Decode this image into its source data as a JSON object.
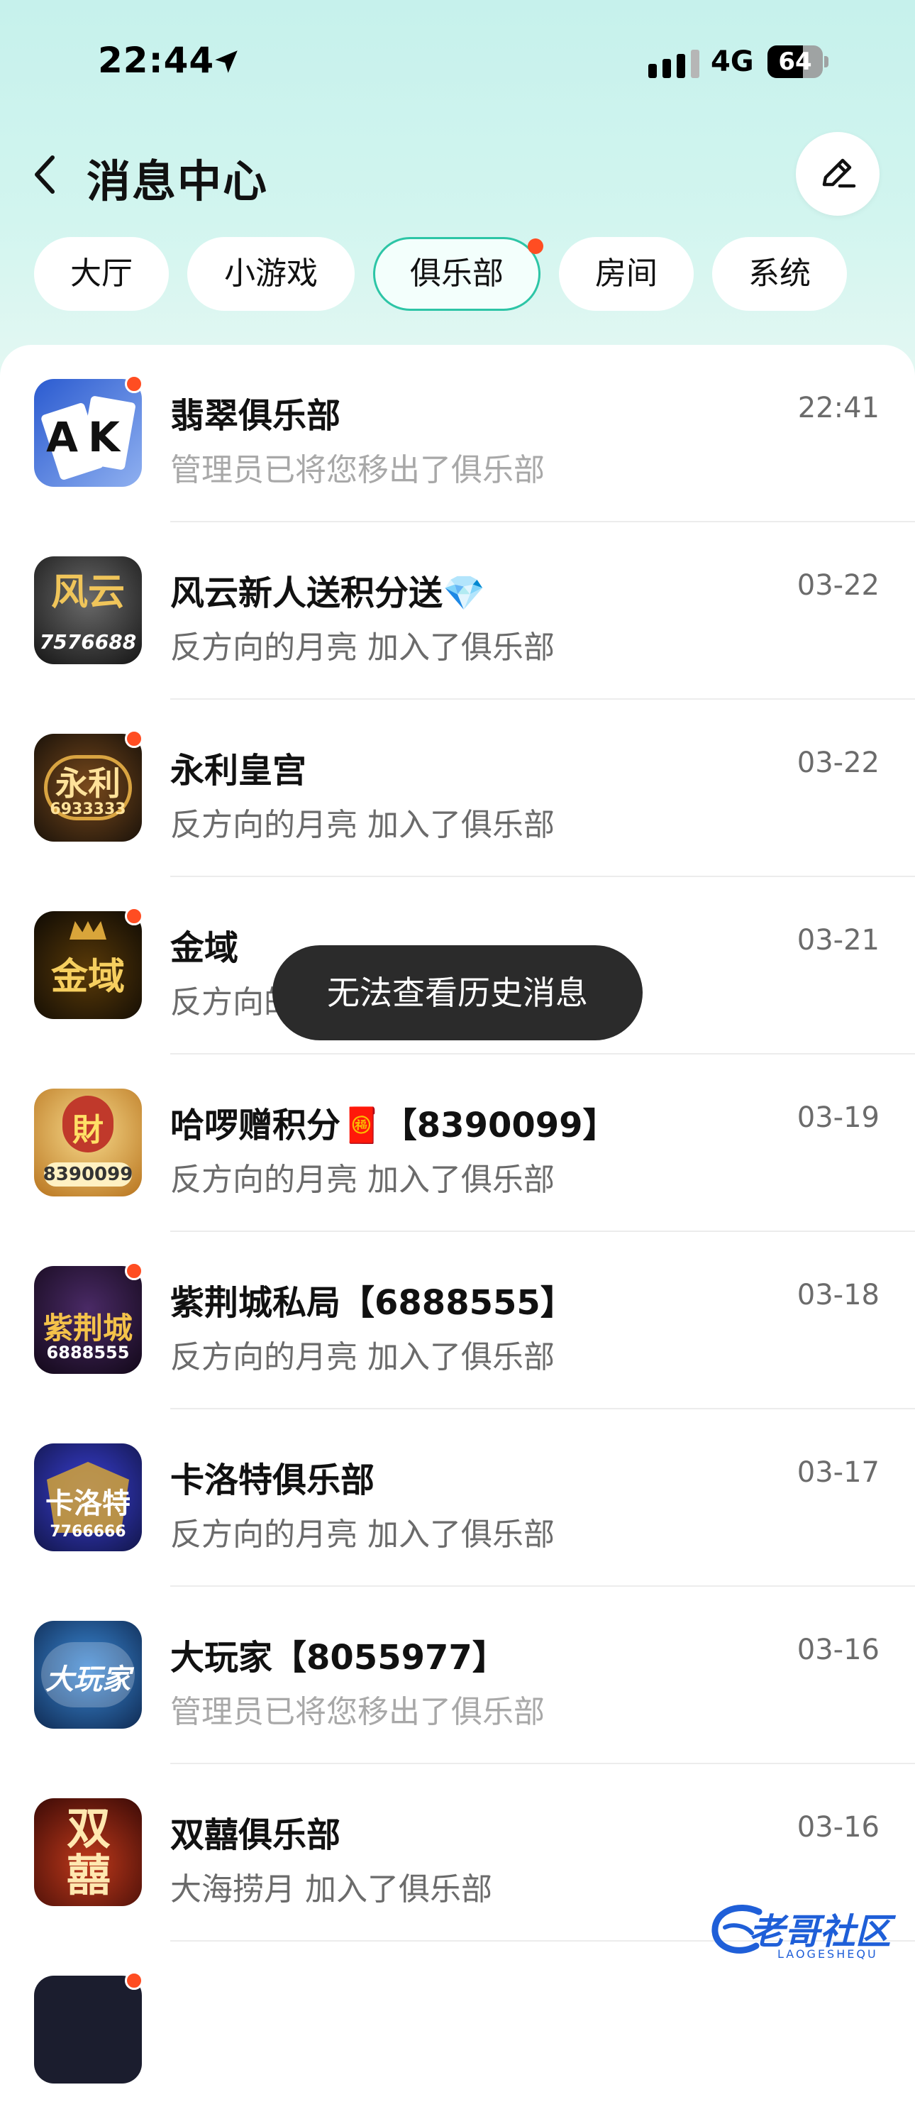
{
  "status_bar": {
    "time": "22:44",
    "network": "4G",
    "battery": "64",
    "battery_level": 0.64
  },
  "header": {
    "title": "消息中心"
  },
  "tabs": [
    {
      "label": "大厅"
    },
    {
      "label": "小游戏"
    },
    {
      "label": "俱乐部",
      "active": true,
      "has_dot": true
    },
    {
      "label": "房间"
    },
    {
      "label": "系统"
    }
  ],
  "messages": [
    {
      "name": "翡翠俱乐部",
      "message": "管理员已将您移出了俱乐部",
      "time": "22:41",
      "unread": true,
      "avatar_text": "AK"
    },
    {
      "name": "风云新人送积分送💎",
      "message": "反方向的月亮 加入了俱乐部",
      "time": "03-22",
      "unread": false,
      "avatar_text": "风云",
      "avatar_sub": "7576688"
    },
    {
      "name": "永利皇宫",
      "message": "反方向的月亮 加入了俱乐部",
      "time": "03-22",
      "unread": true,
      "avatar_text": "永利",
      "avatar_sub": "6933333"
    },
    {
      "name": "金域",
      "message": "反方向的月亮 加入了俱乐部",
      "time": "03-21",
      "unread": true,
      "avatar_text": "金域"
    },
    {
      "name": "哈啰赠积分🧧【8390099】",
      "message": "反方向的月亮 加入了俱乐部",
      "time": "03-19",
      "unread": false,
      "avatar_text": "財",
      "avatar_sub": "8390099"
    },
    {
      "name": "紫荆城私局【6888555】",
      "message": "反方向的月亮 加入了俱乐部",
      "time": "03-18",
      "unread": true,
      "avatar_text": "紫荆城",
      "avatar_sub": "6888555"
    },
    {
      "name": "卡洛特俱乐部",
      "message": "反方向的月亮 加入了俱乐部",
      "time": "03-17",
      "unread": false,
      "avatar_text": "卡洛特",
      "avatar_sub": "7766666"
    },
    {
      "name": "大玩家【8055977】",
      "message": "管理员已将您移出了俱乐部",
      "time": "03-16",
      "unread": false,
      "avatar_text": "大玩家"
    },
    {
      "name": "双囍俱乐部",
      "message": "大海捞月 加入了俱乐部",
      "time": "03-16",
      "unread": false,
      "avatar_text": "双囍"
    }
  ],
  "toast": {
    "text": "无法查看历史消息"
  },
  "watermark": {
    "text": "老哥社区",
    "sub": "LAOGESHEQU"
  },
  "colors": {
    "accent": "#2dc5a6",
    "dot": "#ff4d22",
    "toast_bg": "#2b2b2b"
  }
}
